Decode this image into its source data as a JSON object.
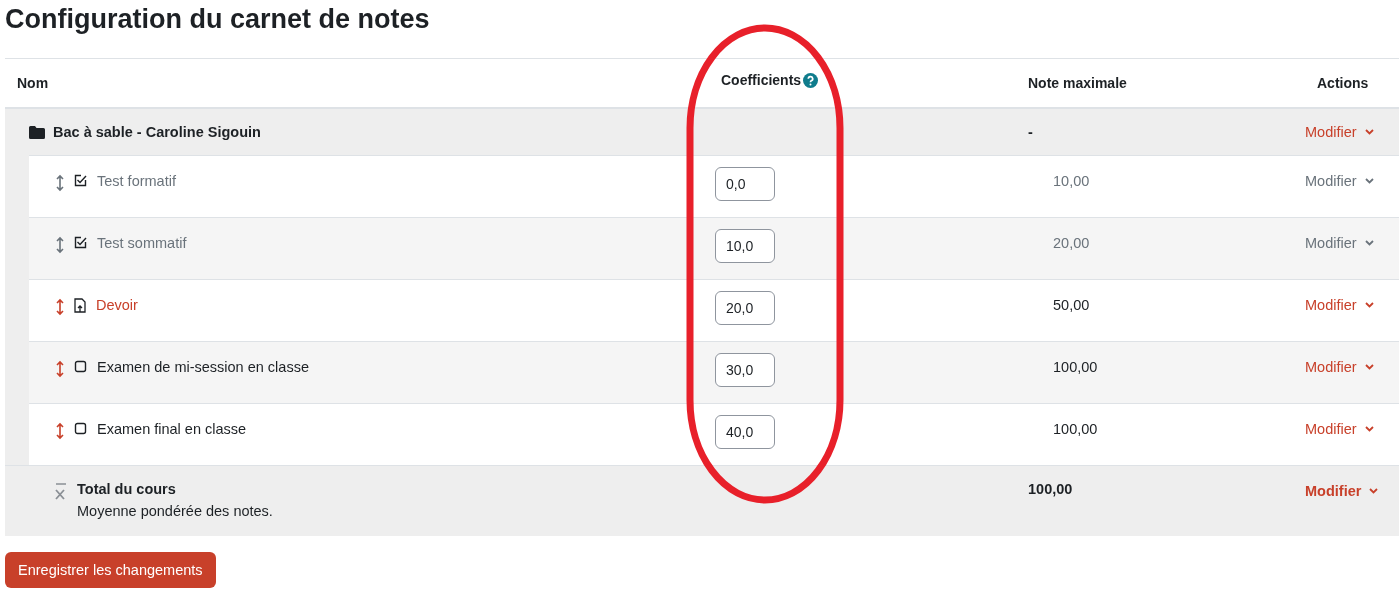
{
  "title": "Configuration du carnet de notes",
  "table": {
    "columns": [
      "Nom",
      "Coefficients",
      "Note maximale",
      "Actions"
    ],
    "category": {
      "name": "Bac à sable - Caroline Sigouin",
      "max_grade": "-",
      "action": "Modifier"
    },
    "items": [
      {
        "kind": "quiz",
        "name": "Test formatif",
        "hidden": true,
        "link": true,
        "coefficient": "0,0",
        "max_grade": "10,00",
        "action": "Modifier"
      },
      {
        "kind": "quiz",
        "name": "Test sommatif",
        "hidden": true,
        "link": true,
        "coefficient": "10,0",
        "max_grade": "20,00",
        "action": "Modifier"
      },
      {
        "kind": "assignment",
        "name": "Devoir",
        "hidden": false,
        "link": true,
        "coefficient": "20,0",
        "max_grade": "50,00",
        "action": "Modifier"
      },
      {
        "kind": "manual",
        "name": "Examen de mi-session en classe",
        "hidden": false,
        "link": false,
        "coefficient": "30,0",
        "max_grade": "100,00",
        "action": "Modifier"
      },
      {
        "kind": "manual",
        "name": "Examen final en classe",
        "hidden": false,
        "link": false,
        "coefficient": "40,0",
        "max_grade": "100,00",
        "action": "Modifier"
      }
    ],
    "total": {
      "name": "Total du cours",
      "description": "Moyenne pondérée des notes.",
      "max_grade": "100,00",
      "action": "Modifier"
    }
  },
  "save_button": "Enregistrer les changements"
}
